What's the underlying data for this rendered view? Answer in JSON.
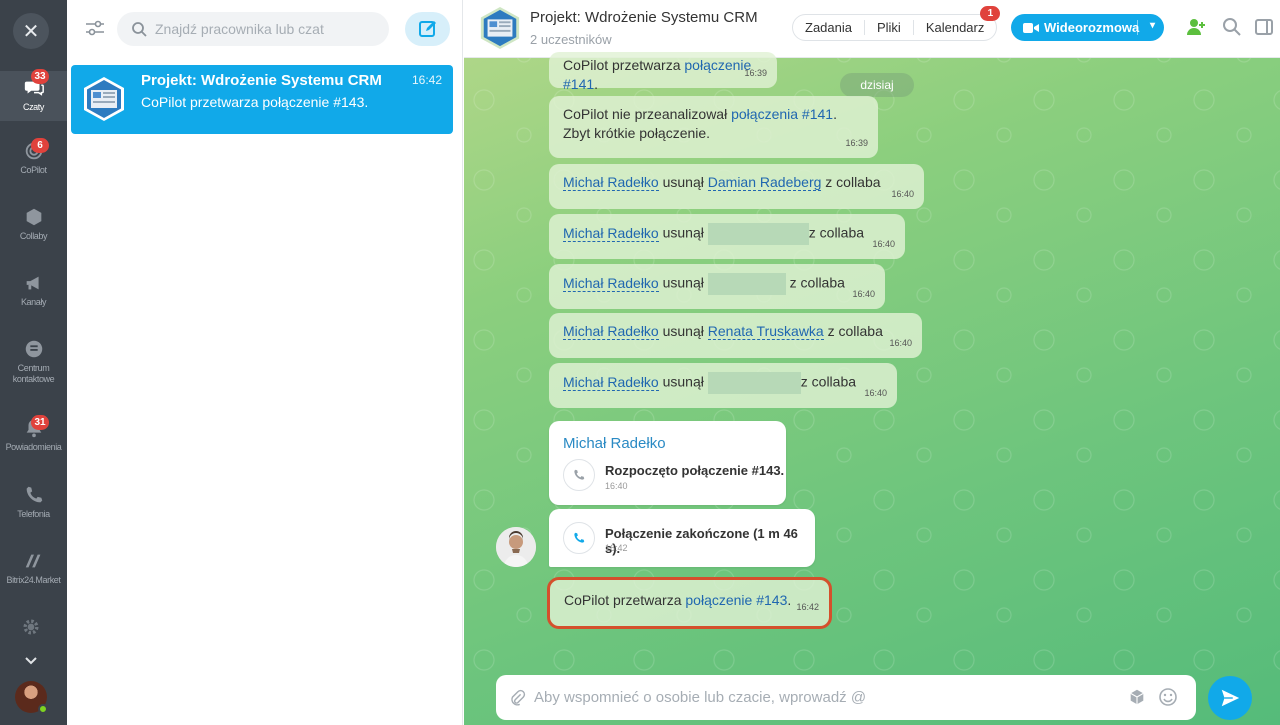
{
  "rail": {
    "close_icon": "close-icon",
    "items": [
      {
        "label": "Czaty",
        "badge": "33",
        "icon": "chat-icon"
      },
      {
        "label": "CoPilot",
        "badge": "6",
        "icon": "copilot-icon"
      },
      {
        "label": "Collaby",
        "badge": "",
        "icon": "collab-icon"
      },
      {
        "label": "Kanały",
        "badge": "",
        "icon": "megaphone-icon"
      },
      {
        "label": "Centrum kontaktowe",
        "badge": "",
        "icon": "contact-center-icon"
      },
      {
        "label": "Powiadomienia",
        "badge": "31",
        "icon": "bell-icon"
      },
      {
        "label": "Telefonia",
        "badge": "",
        "icon": "phone-icon"
      },
      {
        "label": "Bitrix24.Market",
        "badge": "",
        "icon": "market-icon"
      }
    ]
  },
  "list": {
    "search_placeholder": "Znajdź pracownika lub czat",
    "chat": {
      "title": "Projekt: Wdrożenie Systemu CRM",
      "time": "16:42",
      "preview": "CoPilot przetwarza połączenie #143."
    }
  },
  "header": {
    "title": "Projekt: Wdrożenie Systemu CRM",
    "subtitle": "2 uczestników",
    "tabs": [
      "Zadania",
      "Pliki",
      "Kalendarz"
    ],
    "calendar_badge": "1",
    "video_label": "Wideorozmowa"
  },
  "messages": {
    "m0": {
      "prefix": "CoPilot przetwarza ",
      "link": "połączenie #141",
      "suffix": ".",
      "time": "16:39"
    },
    "date_pill": "dzisiaj",
    "m1": {
      "prefix": "CoPilot nie przeanalizował ",
      "link": "połączenia #141",
      "suffix": ".",
      "line2": "Zbyt krótkie połączenie.",
      "time": "16:39"
    },
    "r1": {
      "actor": "Michał Radełko",
      "verb": "usunął",
      "target": "Damian Radeberg",
      "suffix": "z collaba",
      "time": "16:40"
    },
    "r2": {
      "actor": "Michał Radełko",
      "verb": "usunął",
      "suffix": "z collaba",
      "time": "16:40"
    },
    "r3": {
      "actor": "Michał Radełko",
      "verb": "usunął",
      "suffix": "z collaba",
      "time": "16:40"
    },
    "r4": {
      "actor": "Michał Radełko",
      "verb": "usunął",
      "target": "Renata Truskawka",
      "suffix": "z collaba",
      "time": "16:40"
    },
    "r5": {
      "actor": "Michał Radełko",
      "verb": "usunął",
      "suffix": "z collaba",
      "time": "16:40"
    },
    "card": {
      "author": "Michał Radełko",
      "call_start": "Rozpoczęto połączenie #143.",
      "call_start_time": "16:40",
      "call_end": "Połączenie zakończone (1 m 46 s).",
      "call_end_time": "16:42"
    },
    "last": {
      "prefix": "CoPilot przetwarza ",
      "link": "połączenie #143",
      "suffix": ".",
      "time": "16:42"
    }
  },
  "composer": {
    "placeholder": "Aby wspomnieć o osobie lub czacie, wprowadź @"
  },
  "colors": {
    "accent": "#11a9e9",
    "badge": "#e0423c",
    "highlight": "#d4502c"
  }
}
